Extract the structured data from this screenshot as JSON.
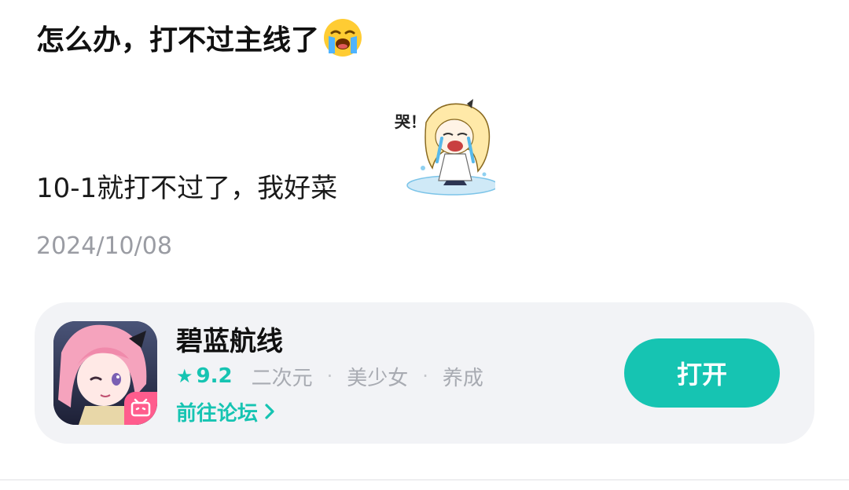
{
  "post": {
    "title": "怎么办，打不过主线了",
    "title_emoji": "loudly-crying-face-icon",
    "body": "10-1就打不过了，我好菜",
    "sticker": "crying-anime-girl-sticker",
    "sticker_text": "哭！",
    "date": "2024/10/08"
  },
  "game_card": {
    "name": "碧蓝航线",
    "rating": "9.2",
    "tags": [
      "二次元",
      "美少女",
      "养成"
    ],
    "forum_link": "前往论坛",
    "open_label": "打开",
    "icon": "azur-lane-app-icon",
    "accent_color": "#16c4b2"
  }
}
